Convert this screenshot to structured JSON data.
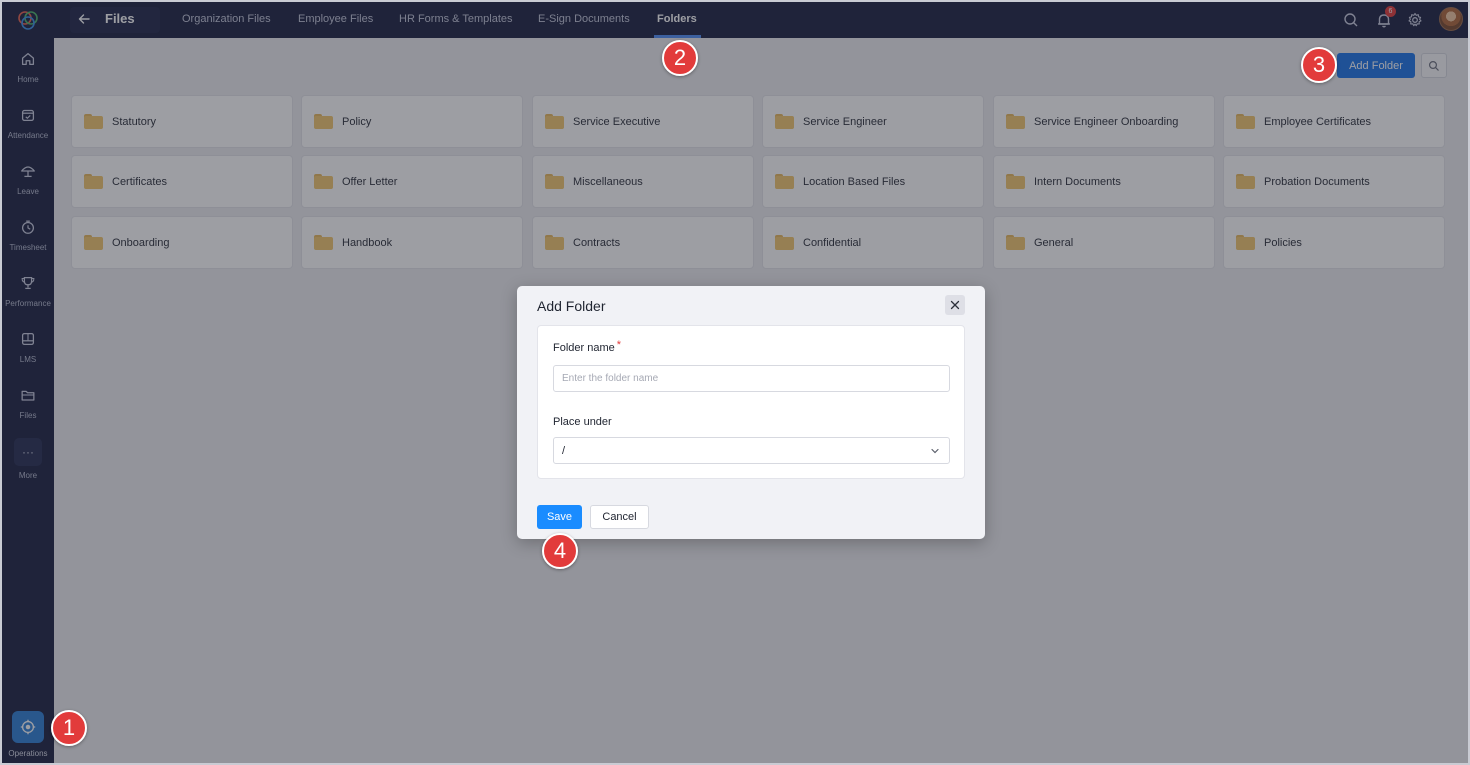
{
  "sidebar": {
    "items": [
      {
        "label": "Home",
        "icon": "home-icon"
      },
      {
        "label": "Attendance",
        "icon": "calendar-icon"
      },
      {
        "label": "Leave",
        "icon": "umbrella-icon"
      },
      {
        "label": "Timesheet",
        "icon": "clock-icon"
      },
      {
        "label": "Performance",
        "icon": "trophy-icon"
      },
      {
        "label": "LMS",
        "icon": "book-icon"
      },
      {
        "label": "Files",
        "icon": "folder-icon"
      },
      {
        "label": "More",
        "icon": "more-icon"
      }
    ],
    "more_glyph": "···",
    "operations_label": "Operations"
  },
  "header": {
    "title": "Files",
    "tabs": [
      {
        "label": "Organization Files"
      },
      {
        "label": "Employee Files"
      },
      {
        "label": "HR Forms & Templates"
      },
      {
        "label": "E-Sign Documents"
      },
      {
        "label": "Folders",
        "active": true
      }
    ],
    "notification_count": "6"
  },
  "toolbar": {
    "add_folder_label": "Add Folder"
  },
  "folders": [
    {
      "name": "Statutory"
    },
    {
      "name": "Policy"
    },
    {
      "name": "Service Executive"
    },
    {
      "name": "Service Engineer"
    },
    {
      "name": "Service Engineer Onboarding"
    },
    {
      "name": "Employee Certificates"
    },
    {
      "name": "Certificates"
    },
    {
      "name": "Offer Letter"
    },
    {
      "name": "Miscellaneous"
    },
    {
      "name": "Location Based Files"
    },
    {
      "name": "Intern Documents"
    },
    {
      "name": "Probation Documents"
    },
    {
      "name": "Onboarding"
    },
    {
      "name": "Handbook"
    },
    {
      "name": "Contracts"
    },
    {
      "name": "Confidential"
    },
    {
      "name": "General"
    },
    {
      "name": "Policies"
    }
  ],
  "modal": {
    "title": "Add Folder",
    "folder_name_label": "Folder name",
    "required_marker": "*",
    "folder_name_placeholder": "Enter the folder name",
    "folder_name_value": "",
    "place_under_label": "Place under",
    "place_under_value": "/",
    "save_label": "Save",
    "cancel_label": "Cancel"
  },
  "steps": [
    "1",
    "2",
    "3",
    "4"
  ],
  "colors": {
    "sidebar_bg": "#1a2040",
    "primary_button": "#1a73e8",
    "save_button": "#1a8cff",
    "step_marker": "#e23b3b",
    "folder": "#f2c66d"
  }
}
